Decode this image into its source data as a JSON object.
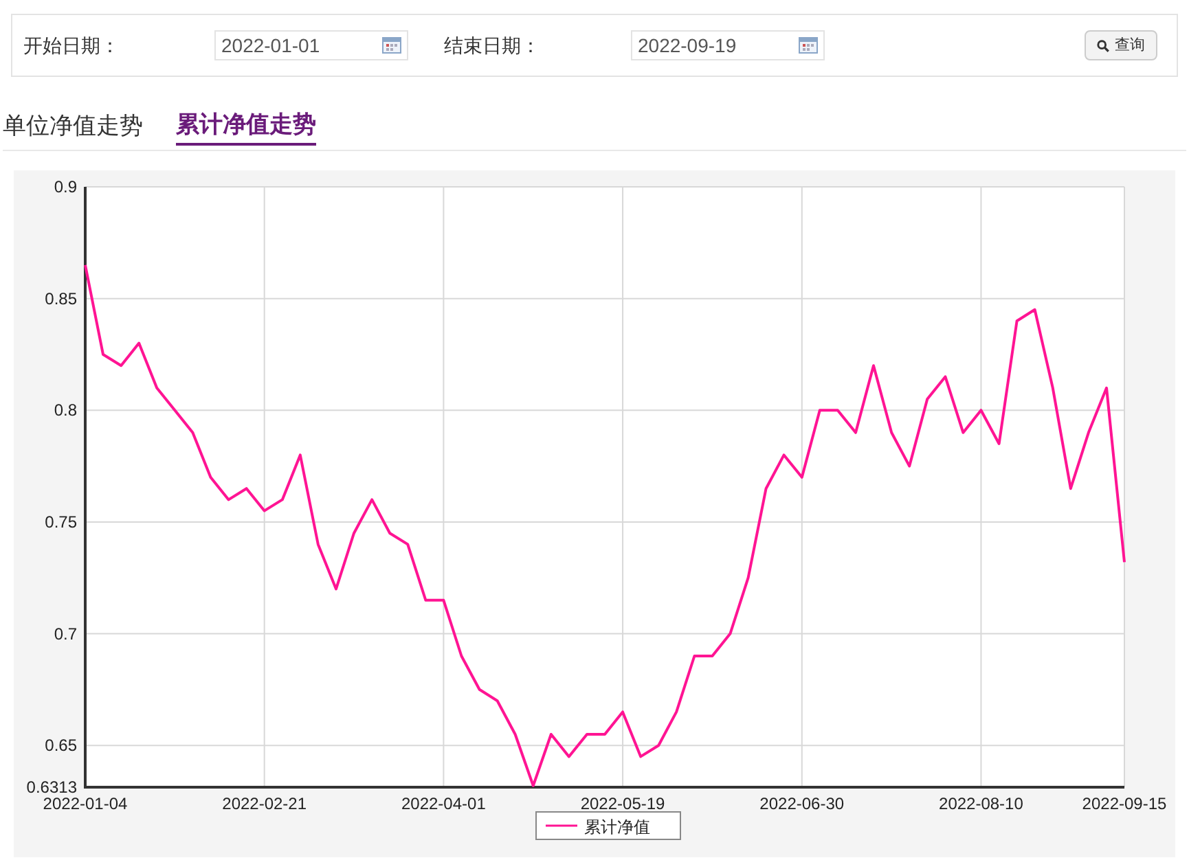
{
  "filter": {
    "start_label": "开始日期：",
    "start_value": "2022-01-01",
    "end_label": "结束日期：",
    "end_value": "2022-09-19",
    "query_button": "查询"
  },
  "tabs": [
    {
      "label": "单位净值走势",
      "selected": false
    },
    {
      "label": "累计净值走势",
      "selected": true
    }
  ],
  "chart": {
    "chart_data": {
      "type": "line",
      "categories": [
        "2022-01-04",
        null,
        null,
        null,
        null,
        null,
        null,
        null,
        null,
        null,
        "2022-02-21",
        null,
        null,
        null,
        null,
        null,
        null,
        null,
        null,
        null,
        "2022-04-01",
        null,
        null,
        null,
        null,
        null,
        null,
        null,
        null,
        null,
        "2022-05-19",
        null,
        null,
        null,
        null,
        null,
        null,
        null,
        null,
        null,
        "2022-06-30",
        null,
        null,
        null,
        null,
        null,
        null,
        null,
        null,
        null,
        "2022-08-10",
        null,
        null,
        null,
        null,
        null,
        null,
        null,
        "2022-09-15"
      ],
      "series": [
        {
          "name": "累计净值",
          "color": "#ff1493",
          "values": [
            0.865,
            0.825,
            0.82,
            0.83,
            0.81,
            0.8,
            0.79,
            0.77,
            0.76,
            0.765,
            0.755,
            0.76,
            0.78,
            0.74,
            0.72,
            0.745,
            0.76,
            0.745,
            0.74,
            0.715,
            0.715,
            0.69,
            0.675,
            0.67,
            0.655,
            0.632,
            0.655,
            0.645,
            0.655,
            0.655,
            0.665,
            0.645,
            0.65,
            0.665,
            0.69,
            0.69,
            0.7,
            0.725,
            0.765,
            0.78,
            0.77,
            0.8,
            0.8,
            0.79,
            0.82,
            0.79,
            0.775,
            0.805,
            0.815,
            0.79,
            0.8,
            0.785,
            0.84,
            0.845,
            0.81,
            0.765,
            0.79,
            0.81,
            0.732
          ]
        }
      ],
      "ylim": [
        0.6313,
        0.9
      ],
      "grid": true,
      "yticks": [
        0.6313,
        0.65,
        0.7,
        0.75,
        0.8,
        0.85,
        0.9
      ]
    }
  }
}
